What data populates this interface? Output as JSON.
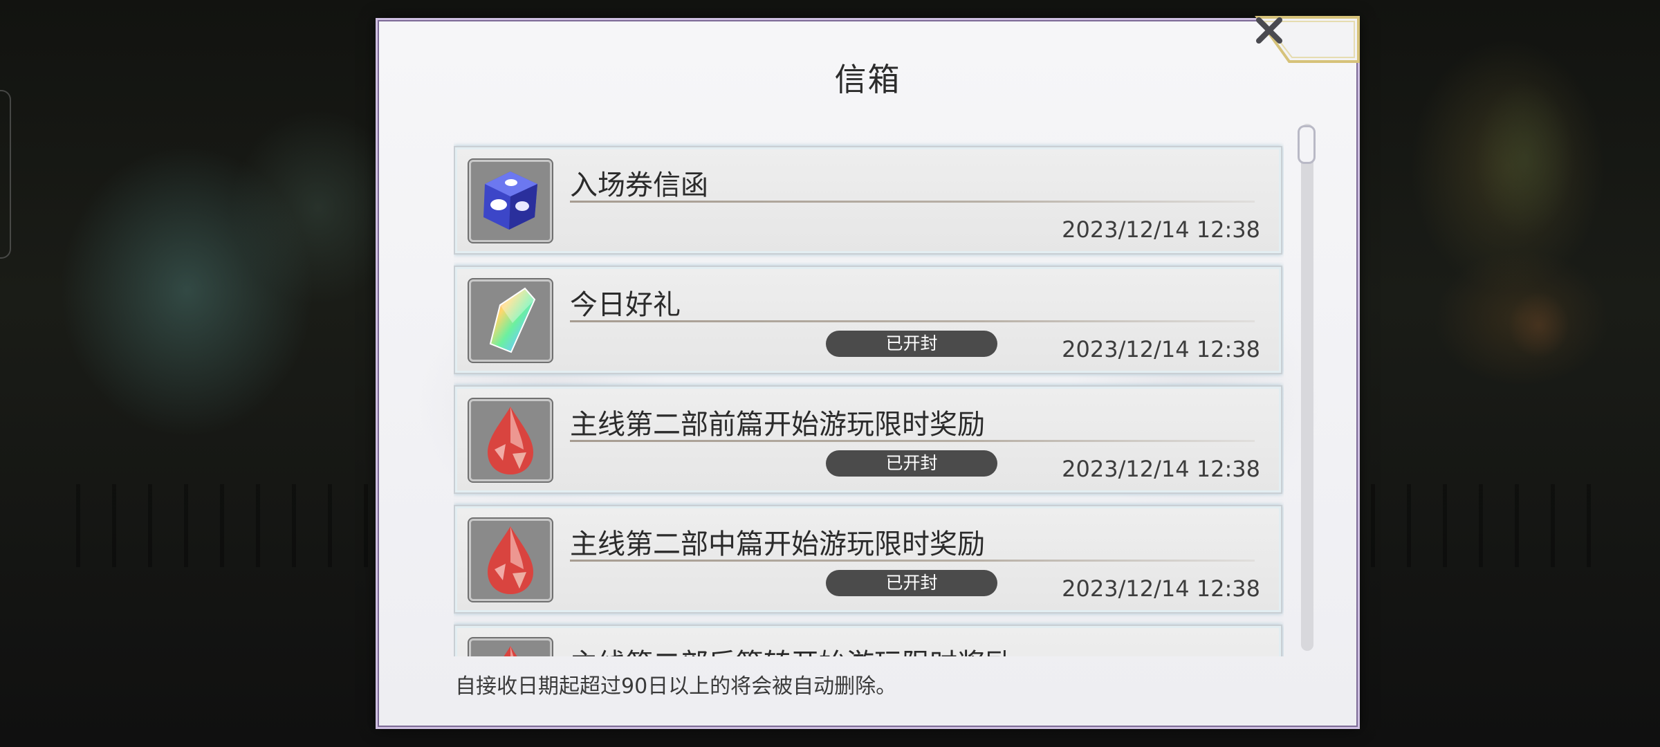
{
  "dialog": {
    "title": "信箱",
    "footer_note": "自接收日期起超过90日以上的将会被自动删除。",
    "close_icon": "close-icon"
  },
  "mails": [
    {
      "title": "入场券信函",
      "date": "2023/12/14 12:38",
      "badge": "",
      "icon": "blue-dice-icon"
    },
    {
      "title": "今日好礼",
      "date": "2023/12/14 12:38",
      "badge": "已开封",
      "icon": "rainbow-crystal-icon"
    },
    {
      "title": "主线第二部前篇开始游玩限时奖励",
      "date": "2023/12/14 12:38",
      "badge": "已开封",
      "icon": "red-gem-icon"
    },
    {
      "title": "主线第二部中篇开始游玩限时奖励",
      "date": "2023/12/14 12:38",
      "badge": "已开封",
      "icon": "red-gem-icon"
    },
    {
      "title": "主线第二部后篇转开始游玩限时奖励",
      "date": "",
      "badge": "",
      "icon": "red-gem-icon"
    }
  ],
  "colors": {
    "dialog_border": "#cfc0e2",
    "badge": "#4b4b4b",
    "close_frame": "#d6c27a"
  }
}
